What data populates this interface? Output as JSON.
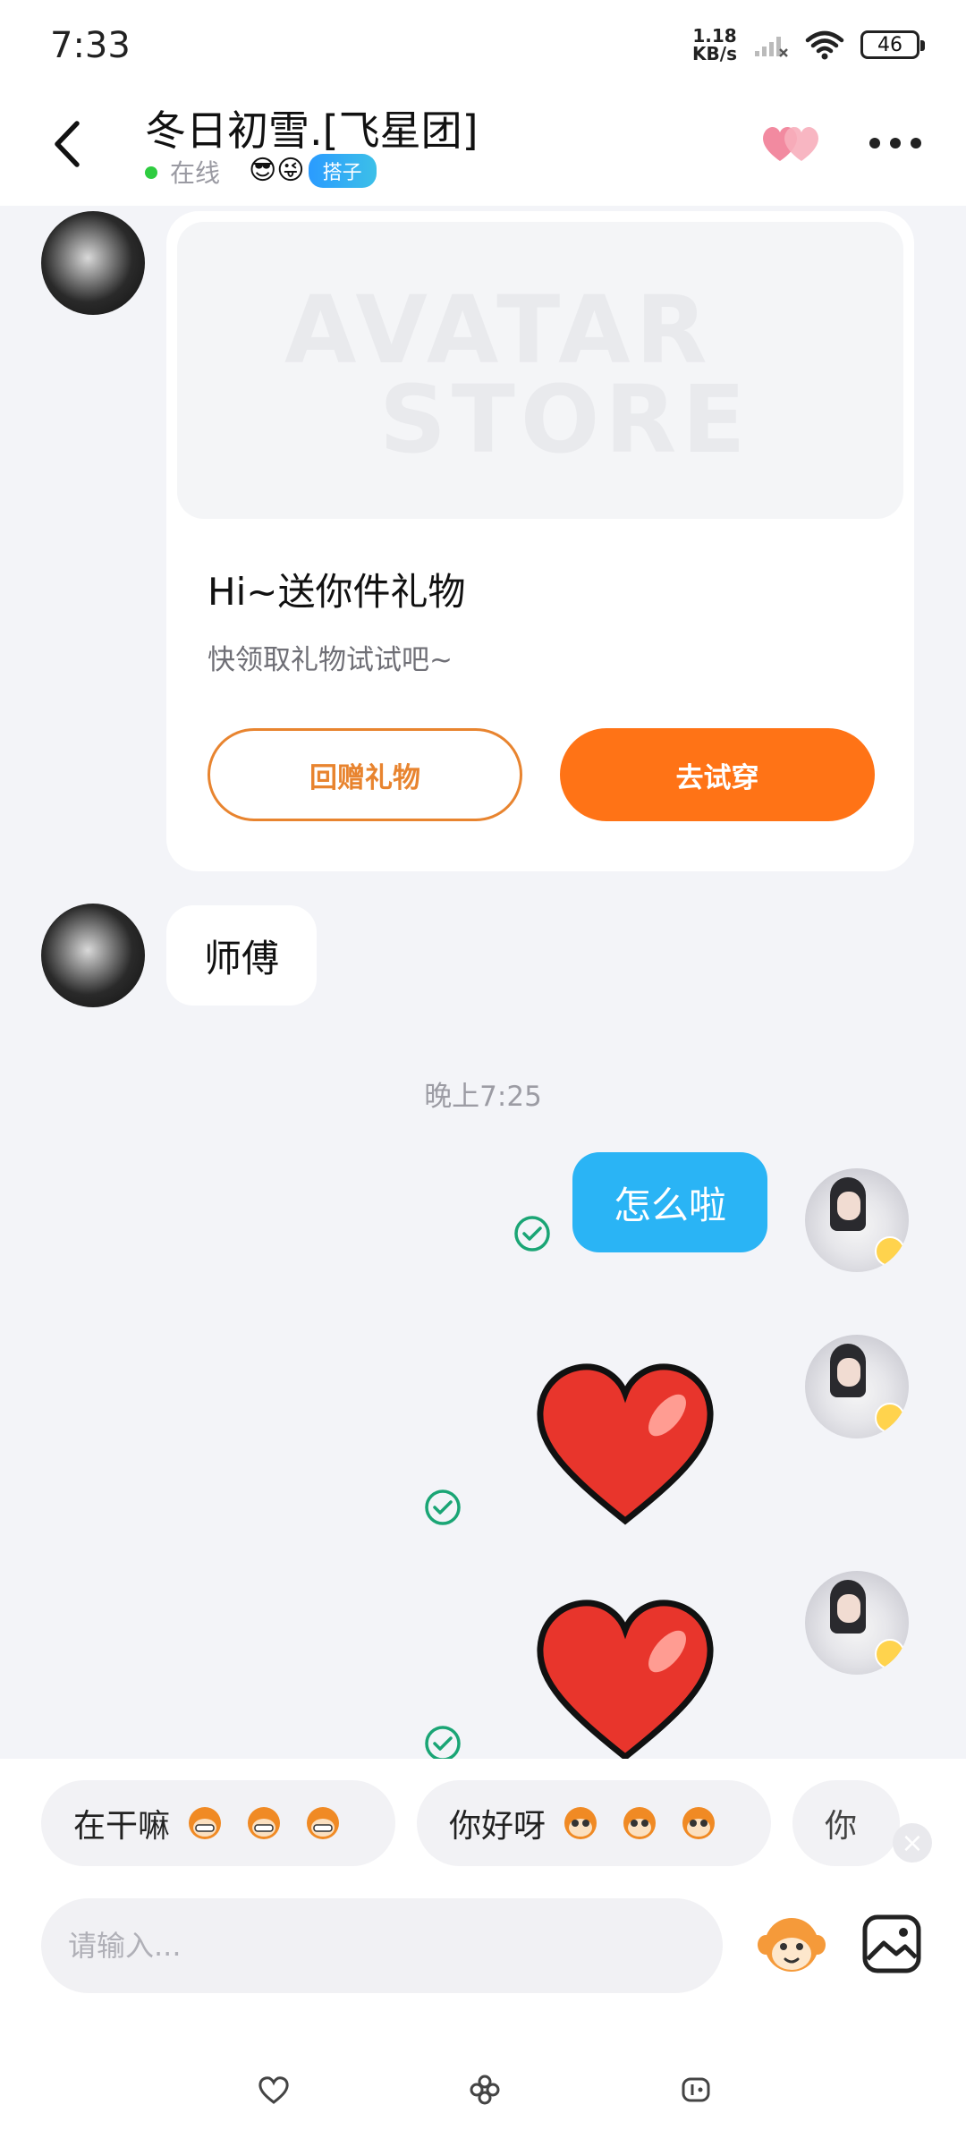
{
  "status_bar": {
    "time": "7:33",
    "net_speed_value": "1.18",
    "net_speed_unit": "KB/s",
    "battery": "46"
  },
  "header": {
    "title": "冬日初雪.[飞星团]",
    "status": "在线",
    "tag_label": "搭子"
  },
  "messages": {
    "gift_card": {
      "title": "Hi~送你件礼物",
      "subtitle": "快领取礼物试试吧~",
      "return_gift_label": "回赠礼物",
      "try_on_label": "去试穿",
      "banner_line1": "AVATAR",
      "banner_line2": "STORE"
    },
    "received_text": "师傅",
    "timestamp": "晚上7:25",
    "sent_text": "怎么啦"
  },
  "quick_replies": [
    {
      "text": "在干嘛"
    },
    {
      "text": "你好呀"
    },
    {
      "text": "你"
    }
  ],
  "composer": {
    "placeholder": "请输入..."
  },
  "colors": {
    "accent_orange": "#ff7316",
    "bubble_blue": "#2ab4f5",
    "online_green": "#2ecc40",
    "check_green": "#1aa575"
  }
}
